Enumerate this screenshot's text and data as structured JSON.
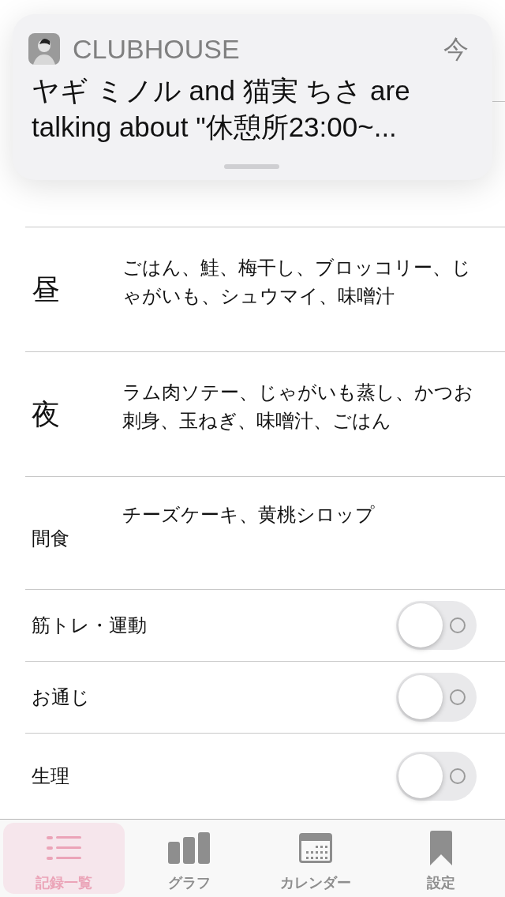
{
  "notification": {
    "app": "CLUBHOUSE",
    "time": "今",
    "message": "ヤギ ミノル and 猫実 ちさ are talking about \"休憩所23:00~..."
  },
  "meals": [
    {
      "label": "昼",
      "kind": "large",
      "foods": "ごはん、鮭、梅干し、ブロッコリー、じゃがいも、シュウマイ、味噌汁"
    },
    {
      "label": "夜",
      "kind": "large",
      "foods": "ラム肉ソテー、じゃがいも蒸し、かつお刺身、玉ねぎ、味噌汁、ごはん"
    },
    {
      "label": "間食",
      "kind": "small",
      "foods": "チーズケーキ、黄桃シロップ"
    }
  ],
  "toggles": [
    {
      "label": "筋トレ・運動",
      "on": false
    },
    {
      "label": "お通じ",
      "on": false
    },
    {
      "label": "生理",
      "on": false
    }
  ],
  "tab_bar": [
    {
      "label": "記録一覧",
      "kind": "list",
      "selected": true
    },
    {
      "label": "グラフ",
      "kind": "graph",
      "selected": false
    },
    {
      "label": "カレンダー",
      "kind": "calendar",
      "selected": false
    },
    {
      "label": "設定",
      "kind": "bookmark",
      "selected": false
    }
  ]
}
